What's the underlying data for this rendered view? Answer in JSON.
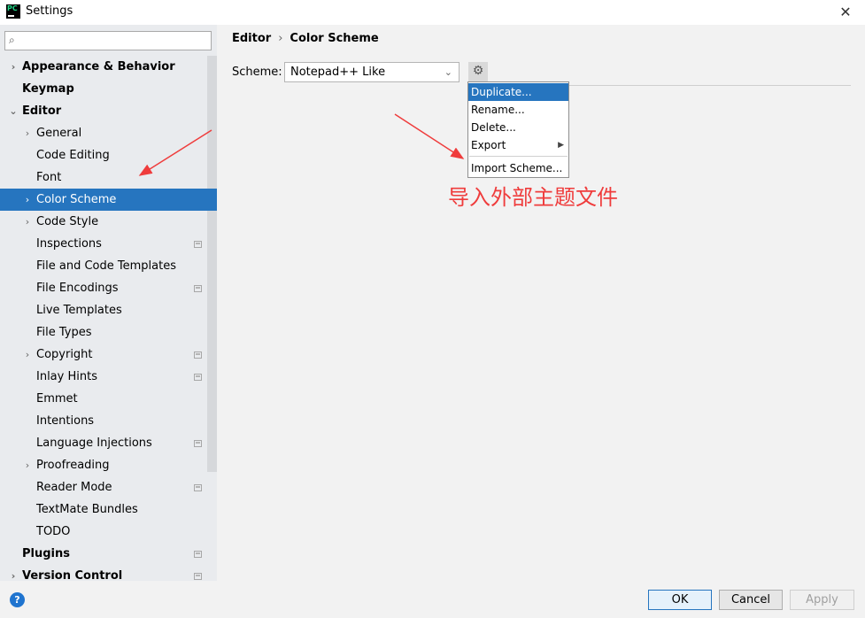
{
  "window": {
    "title": "Settings",
    "logo_text": "PC",
    "close_glyph": "✕"
  },
  "sidebar": {
    "search_glyph": "⌕",
    "items": [
      {
        "label": "Appearance & Behavior",
        "bold": true,
        "level": 0,
        "arrow": "›",
        "project": false,
        "selected": false
      },
      {
        "label": "Keymap",
        "bold": true,
        "level": 0,
        "arrow": "",
        "project": false,
        "selected": false
      },
      {
        "label": "Editor",
        "bold": true,
        "level": 0,
        "arrow": "⌄",
        "project": false,
        "selected": false
      },
      {
        "label": "General",
        "bold": false,
        "level": 1,
        "arrow": "›",
        "project": false,
        "selected": false
      },
      {
        "label": "Code Editing",
        "bold": false,
        "level": 1,
        "arrow": "",
        "project": false,
        "selected": false
      },
      {
        "label": "Font",
        "bold": false,
        "level": 1,
        "arrow": "",
        "project": false,
        "selected": false
      },
      {
        "label": "Color Scheme",
        "bold": false,
        "level": 1,
        "arrow": "›",
        "project": false,
        "selected": true
      },
      {
        "label": "Code Style",
        "bold": false,
        "level": 1,
        "arrow": "›",
        "project": false,
        "selected": false
      },
      {
        "label": "Inspections",
        "bold": false,
        "level": 1,
        "arrow": "",
        "project": true,
        "selected": false
      },
      {
        "label": "File and Code Templates",
        "bold": false,
        "level": 1,
        "arrow": "",
        "project": false,
        "selected": false
      },
      {
        "label": "File Encodings",
        "bold": false,
        "level": 1,
        "arrow": "",
        "project": true,
        "selected": false
      },
      {
        "label": "Live Templates",
        "bold": false,
        "level": 1,
        "arrow": "",
        "project": false,
        "selected": false
      },
      {
        "label": "File Types",
        "bold": false,
        "level": 1,
        "arrow": "",
        "project": false,
        "selected": false
      },
      {
        "label": "Copyright",
        "bold": false,
        "level": 1,
        "arrow": "›",
        "project": true,
        "selected": false
      },
      {
        "label": "Inlay Hints",
        "bold": false,
        "level": 1,
        "arrow": "",
        "project": true,
        "selected": false
      },
      {
        "label": "Emmet",
        "bold": false,
        "level": 1,
        "arrow": "",
        "project": false,
        "selected": false
      },
      {
        "label": "Intentions",
        "bold": false,
        "level": 1,
        "arrow": "",
        "project": false,
        "selected": false
      },
      {
        "label": "Language Injections",
        "bold": false,
        "level": 1,
        "arrow": "",
        "project": true,
        "selected": false
      },
      {
        "label": "Proofreading",
        "bold": false,
        "level": 1,
        "arrow": "›",
        "project": false,
        "selected": false
      },
      {
        "label": "Reader Mode",
        "bold": false,
        "level": 1,
        "arrow": "",
        "project": true,
        "selected": false
      },
      {
        "label": "TextMate Bundles",
        "bold": false,
        "level": 1,
        "arrow": "",
        "project": false,
        "selected": false
      },
      {
        "label": "TODO",
        "bold": false,
        "level": 1,
        "arrow": "",
        "project": false,
        "selected": false
      },
      {
        "label": "Plugins",
        "bold": true,
        "level": 0,
        "arrow": "",
        "project": true,
        "selected": false
      },
      {
        "label": "Version Control",
        "bold": true,
        "level": 0,
        "arrow": "›",
        "project": true,
        "selected": false
      }
    ]
  },
  "main": {
    "breadcrumb": {
      "parent": "Editor",
      "separator": "›",
      "current": "Color Scheme"
    },
    "scheme_label": "Scheme:",
    "scheme_value": "Notepad++ Like",
    "dropdown_glyph": "⌄",
    "gear_glyph": "⚙"
  },
  "context_menu": {
    "items": [
      {
        "label": "Duplicate...",
        "highlighted": true,
        "submenu": false
      },
      {
        "label": "Rename...",
        "highlighted": false,
        "submenu": false
      },
      {
        "label": "Delete...",
        "highlighted": false,
        "submenu": false
      },
      {
        "label": "Export",
        "highlighted": false,
        "submenu": true
      },
      {
        "label": "Import Scheme...",
        "highlighted": false,
        "submenu": false
      }
    ],
    "submenu_glyph": "▶"
  },
  "annotation": {
    "text": "导入外部主题文件",
    "color": "#ef3c3c"
  },
  "footer": {
    "help_glyph": "?",
    "ok_label": "OK",
    "cancel_label": "Cancel",
    "apply_label": "Apply"
  },
  "colors": {
    "selection": "#2675bf",
    "sidebar_bg": "#e9ebee",
    "panel_bg": "#f2f2f2"
  }
}
